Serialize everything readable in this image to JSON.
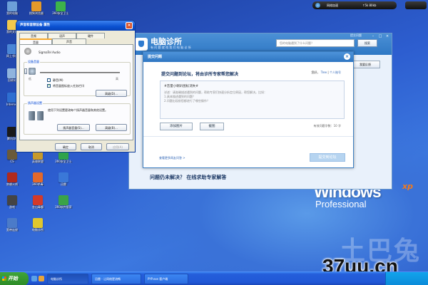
{
  "desktop": {
    "icons": [
      {
        "label": "我的电脑",
        "color": "#6c9fd8"
      },
      {
        "label": "搜狗浏览器",
        "color": "#e59a2a"
      },
      {
        "label": "360安全卫士",
        "color": "#3db34a"
      },
      {
        "label": "我的文档",
        "color": "#f2c94c"
      },
      {
        "label": "网上邻居",
        "color": "#4a86d6"
      },
      {
        "label": "回收站",
        "color": "#8fb4de"
      },
      {
        "label": "Internet",
        "color": "#2e6fd1"
      },
      {
        "label": "腾讯QQ",
        "color": "#1a1a1a"
      },
      {
        "label": "酷狗音乐",
        "color": "#2d7be0"
      },
      {
        "label": "暴风影音",
        "color": "#3a3a3a"
      },
      {
        "label": "CS",
        "color": "#6a5a3a"
      },
      {
        "label": "英雄联盟",
        "color": "#c79a2b"
      },
      {
        "label": "360安全卫士",
        "color": "#2fa34a"
      },
      {
        "label": "穿越火线",
        "color": "#b02a1e"
      },
      {
        "label": "360杀毒",
        "color": "#e3682a"
      },
      {
        "label": "迅雷",
        "color": "#3a78d8"
      },
      {
        "label": "游戏",
        "color": "#444444"
      },
      {
        "label": "金山毒霸",
        "color": "#d33a2a"
      },
      {
        "label": "360软件管家",
        "color": "#3aa348"
      },
      {
        "label": "宽带连接",
        "color": "#4b7bc9"
      },
      {
        "label": "电脑诊所",
        "color": "#e0c72e"
      }
    ]
  },
  "gadget": {
    "label": "网络加速",
    "value1": "↑5k 80kb",
    "value2": ""
  },
  "sound_dialog": {
    "title": "声音和音频设备 属性",
    "tabs": [
      "音量",
      "声音",
      "音频",
      "语声",
      "硬件"
    ],
    "device_name": "SigmaTel Audio",
    "group_volume": "设备音量",
    "check_mute": "静音(M)",
    "check_tray": "将音量图标放入任务栏(I)",
    "advanced_btn": "高级(D)...",
    "group_speaker": "扬声器设置",
    "speaker_text": "使用下列设置更改每个扬声器音量和其他设置。",
    "speaker_vol_btn": "扬声器音量(S)...",
    "advanced_btn2": "高级(B)...",
    "ok": "确定",
    "cancel": "取消",
    "apply": "应用(A)"
  },
  "app_window": {
    "title": "电脑诊所",
    "subtitle": "有 问 题 就 找 我 们 电 脑 诊 所",
    "top_link": "提交问题",
    "search_placeholder": "您的电脑遇到了什么问题？",
    "search_btn": "搜索",
    "feedback_btn": "我要反馈",
    "unsolved_text": "问题仍未解决？ 在线求助专家解答"
  },
  "modal": {
    "header": "提交问题",
    "title": "提交问题到论坛，将由诊所专家帮您解决",
    "author_prefix": "您好，",
    "author_name": "Tree",
    "author_link": "个人账号",
    "subject": "#音量小喇叭图标消失#",
    "lines": [
      "详述：请准确描述遇到的问题，帮助专家们快速分析定位原因，帮您解决。比如：",
      "1.具体描述遇到的问题？",
      "2.问题出现前您都进行了哪些操作？"
    ],
    "add_image": "添加图片",
    "screenshot": "截图",
    "count_text": "有效问题字数：10 字",
    "link": "查看更多网友问答 >",
    "submit": "提交到论坛"
  },
  "watermark": {
    "top": "土巴兔",
    "bottom": "37uu.cn"
  },
  "windows_logo": {
    "main": "Windows",
    "xp": "xp",
    "edition": "Professional"
  },
  "taskbar": {
    "start": "开始",
    "items": [
      "电脑诊所",
      "迅雷 - 让网络更流畅",
      "PYP.exe 客户端"
    ],
    "active_index": 0
  }
}
